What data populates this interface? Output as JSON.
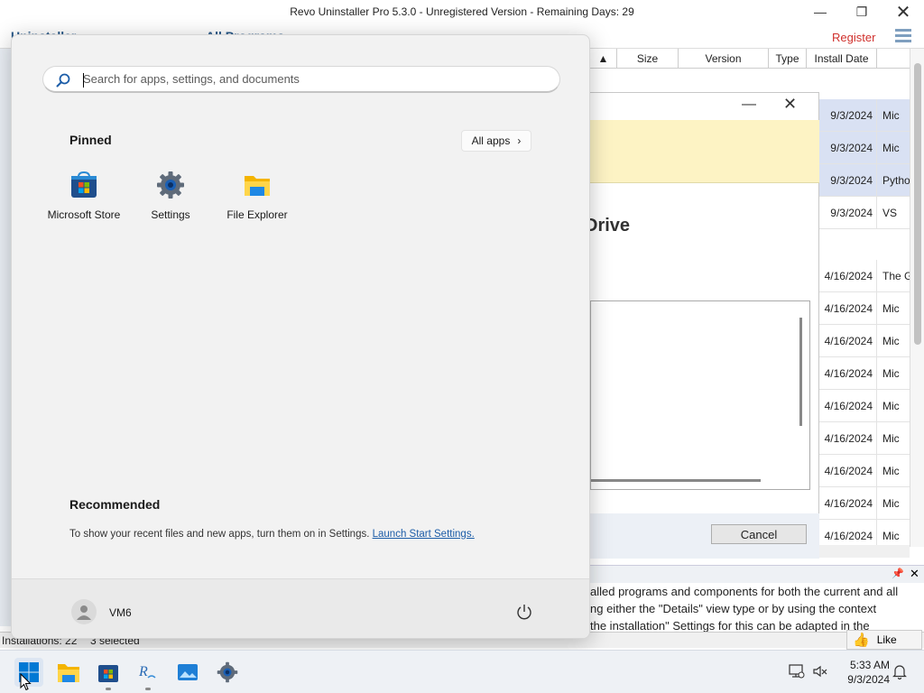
{
  "revo": {
    "title": "Revo Uninstaller Pro 5.3.0 - Unregistered Version - Remaining Days: 29",
    "tab_uninstaller": "Uninstaller",
    "tab_all_programs": "All Programs",
    "register": "Register",
    "columns": [
      "Size",
      "Version",
      "Type",
      "Install Date"
    ],
    "rows": [
      {
        "date": "9/3/2024",
        "name": "Mic",
        "selected": true
      },
      {
        "date": "9/3/2024",
        "name": "Mic",
        "selected": true
      },
      {
        "date": "9/3/2024",
        "name": "Pytho",
        "selected": true
      },
      {
        "date": "9/3/2024",
        "name": "VS",
        "selected": false
      },
      {
        "date": "4/16/2024",
        "name": "The G",
        "selected": false
      },
      {
        "date": "4/16/2024",
        "name": "Mic",
        "selected": false
      },
      {
        "date": "4/16/2024",
        "name": "Mic",
        "selected": false
      },
      {
        "date": "4/16/2024",
        "name": "Mic",
        "selected": false
      },
      {
        "date": "4/16/2024",
        "name": "Mic",
        "selected": false
      },
      {
        "date": "4/16/2024",
        "name": "Mic",
        "selected": false
      },
      {
        "date": "4/16/2024",
        "name": "Mic",
        "selected": false
      },
      {
        "date": "4/16/2024",
        "name": "Mic",
        "selected": false
      },
      {
        "date": "4/16/2024",
        "name": "Mic",
        "selected": false
      }
    ],
    "dialog": {
      "heading_fragment": "Drive",
      "cancel": "Cancel"
    },
    "info_lines": [
      "alled programs and components for both the current and all",
      "ng either the \"Details\" view type or by using the context",
      "the installation\" Settings for this  can be adapted in the"
    ],
    "status_installations": "Installations: 22",
    "status_selected": "3 selected",
    "like": "Like"
  },
  "start_menu": {
    "search_placeholder": "Search for apps, settings, and documents",
    "pinned_label": "Pinned",
    "all_apps": "All apps",
    "pinned": [
      {
        "label": "Microsoft Store",
        "icon": "microsoft-store-icon"
      },
      {
        "label": "Settings",
        "icon": "settings-gear-icon"
      },
      {
        "label": "File Explorer",
        "icon": "folder-icon"
      }
    ],
    "recommended_label": "Recommended",
    "recommended_text": "To show your recent files and new apps, turn them on in Settings.",
    "recommended_link": "Launch Start Settings.",
    "user": "VM6"
  },
  "taskbar": {
    "time": "5:33 AM",
    "date": "9/3/2024",
    "apps": [
      "start-icon",
      "file-explorer-icon",
      "microsoft-store-icon",
      "revo-uninstaller-icon",
      "photos-icon",
      "settings-gear-icon"
    ]
  },
  "colors": {
    "accent": "#0067c0",
    "register_red": "#d0312d",
    "selected_row": "#d9e1f3",
    "dialog_band": "#fdf3c4"
  }
}
